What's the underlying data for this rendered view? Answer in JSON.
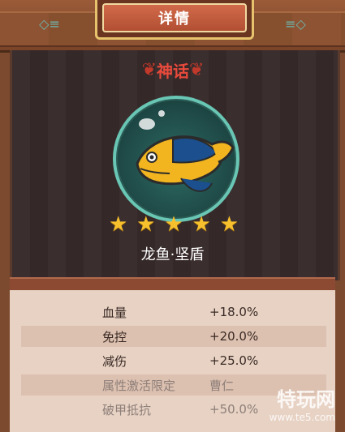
{
  "header": {
    "title": "详情"
  },
  "item": {
    "rarity": "神话",
    "name": "龙鱼·坚盾",
    "stars": 5
  },
  "stats": [
    {
      "label": "血量",
      "value": "+18.0%",
      "dim": false
    },
    {
      "label": "免控",
      "value": "+20.0%",
      "dim": false
    },
    {
      "label": "减伤",
      "value": "+25.0%",
      "dim": false
    },
    {
      "label": "属性激活限定",
      "value": "曹仁",
      "dim": true
    },
    {
      "label": "破甲抵抗",
      "value": "+50.0%",
      "dim": true
    }
  ],
  "watermark": {
    "text": "特玩网",
    "url": "www.te5.com"
  },
  "icons": {
    "header_left": "fish-ornament-icon",
    "header_right": "fish-ornament-icon",
    "laurel_left": "laurel-icon",
    "laurel_right": "laurel-icon",
    "star": "star-icon",
    "fish": "arowana-fish-icon"
  },
  "colors": {
    "rarity": "#e94a3c",
    "star": "#f6c12c",
    "bubble_border": "#69c6b4"
  }
}
